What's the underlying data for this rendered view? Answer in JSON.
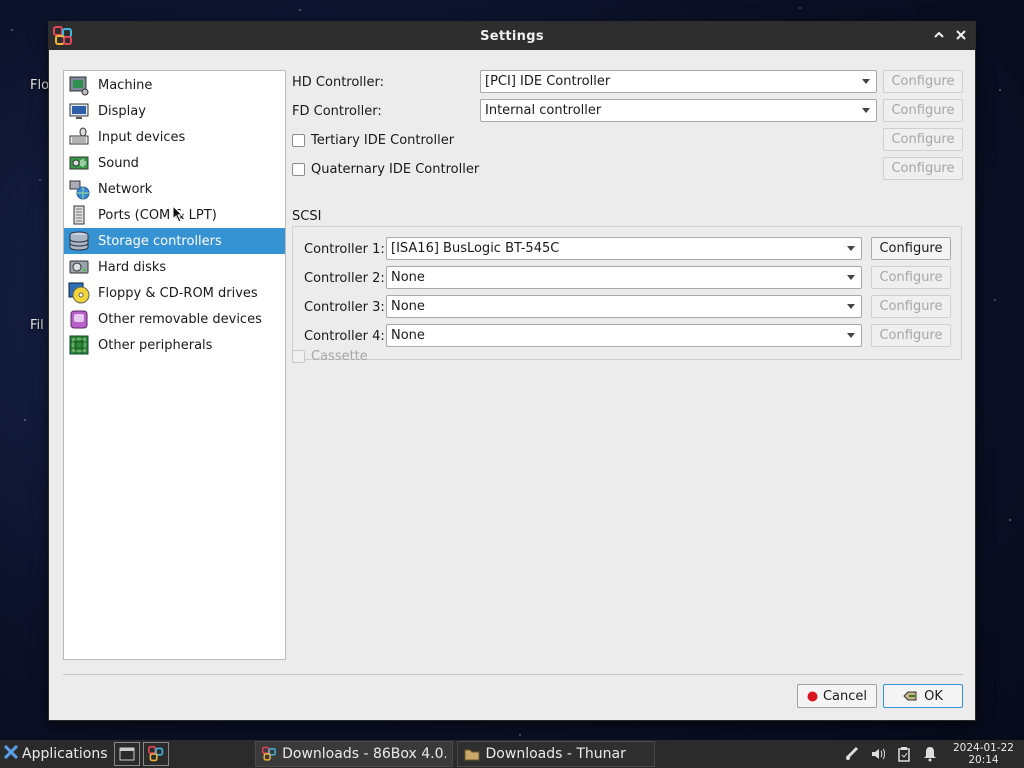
{
  "desktop": {
    "label_1": "Flo",
    "label_2": "Fil"
  },
  "window": {
    "title": "Settings"
  },
  "sidebar": {
    "items": [
      {
        "label": "Machine",
        "icon": "machine-icon",
        "selected": false
      },
      {
        "label": "Display",
        "icon": "display-icon",
        "selected": false
      },
      {
        "label": "Input devices",
        "icon": "input-devices-icon",
        "selected": false
      },
      {
        "label": "Sound",
        "icon": "sound-icon",
        "selected": false
      },
      {
        "label": "Network",
        "icon": "network-icon",
        "selected": false
      },
      {
        "label": "Ports (COM & LPT)",
        "icon": "ports-icon",
        "selected": false
      },
      {
        "label": "Storage controllers",
        "icon": "storage-icon",
        "selected": true
      },
      {
        "label": "Hard disks",
        "icon": "hard-disk-icon",
        "selected": false
      },
      {
        "label": "Floppy & CD-ROM drives",
        "icon": "floppy-cdrom-icon",
        "selected": false
      },
      {
        "label": "Other removable devices",
        "icon": "removable-icon",
        "selected": false
      },
      {
        "label": "Other peripherals",
        "icon": "peripherals-icon",
        "selected": false
      }
    ]
  },
  "main": {
    "hd_controller": {
      "label": "HD Controller:",
      "value": "[PCI] IDE Controller",
      "button": "Configure"
    },
    "fd_controller": {
      "label": "FD Controller:",
      "value": "Internal controller",
      "button": "Configure"
    },
    "tertiary_ide": {
      "label": "Tertiary IDE Controller",
      "checked": false,
      "button": "Configure"
    },
    "quaternary_ide": {
      "label": "Quaternary IDE Controller",
      "checked": false,
      "button": "Configure"
    },
    "scsi": {
      "title": "SCSI",
      "controllers": [
        {
          "label": "Controller 1:",
          "value": "[ISA16] BusLogic BT-545C",
          "button": "Configure",
          "enabled": true
        },
        {
          "label": "Controller 2:",
          "value": "None",
          "button": "Configure",
          "enabled": false
        },
        {
          "label": "Controller 3:",
          "value": "None",
          "button": "Configure",
          "enabled": false
        },
        {
          "label": "Controller 4:",
          "value": "None",
          "button": "Configure",
          "enabled": false
        }
      ]
    },
    "cassette": {
      "label": "Cassette",
      "checked": false,
      "enabled": false
    }
  },
  "footer": {
    "cancel_label": "Cancel",
    "ok_label": "OK"
  },
  "taskbar": {
    "applications_label": "Applications",
    "tasks": [
      {
        "label": "Downloads - 86Box 4.0....",
        "icon": "86box-icon"
      },
      {
        "label": "Downloads - Thunar",
        "icon": "folder-icon"
      }
    ],
    "clock_date": "2024-01-22",
    "clock_time": "20:14"
  },
  "colors": {
    "selection": "#3592d3",
    "titlebar": "#2e2e2e",
    "window_bg": "#ececec",
    "taskbar": "#2b2b2b"
  }
}
